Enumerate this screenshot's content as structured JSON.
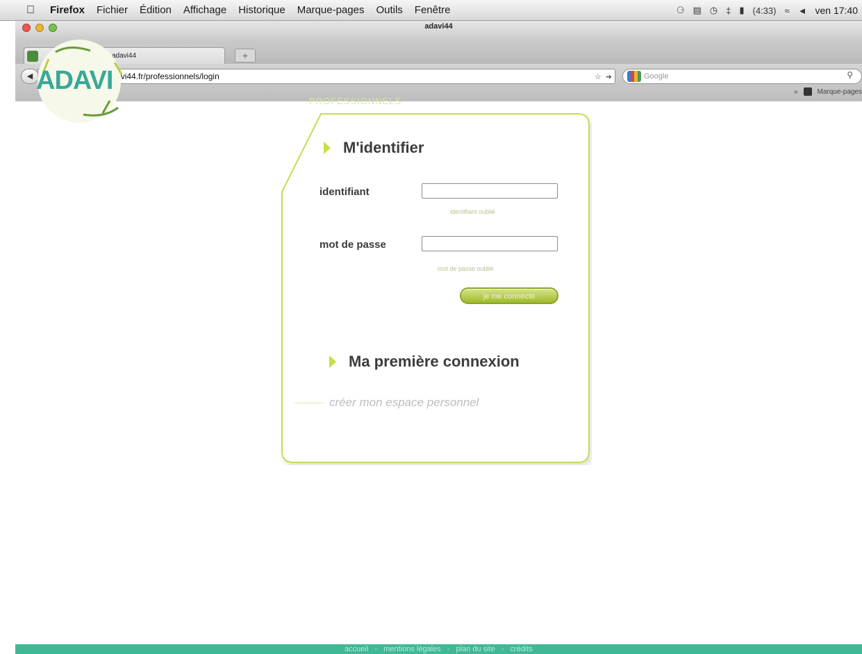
{
  "menubar": {
    "app": "Firefox",
    "items": [
      "Fichier",
      "Édition",
      "Affichage",
      "Historique",
      "Marque-pages",
      "Outils",
      "Fenêtre"
    ],
    "battery": "(4:33)",
    "clock": "ven 17:40"
  },
  "window": {
    "title": "adavi44",
    "tab_label": "adavi44",
    "new_tab": "+"
  },
  "nav": {
    "url": "www.adavi44.fr/professionnels/login",
    "search_placeholder": "Google",
    "bookmarks_label": "Marque-pages"
  },
  "page": {
    "logo_text": "ADAVI",
    "section_label": "PROFESSIONNELS",
    "login_heading": "M'identifier",
    "identifiant_label": "identifiant",
    "identifiant_forgot": "identifiant oublié",
    "password_label": "mot de passe",
    "password_forgot": "mot de passe oublié",
    "submit_label": "je me connecte",
    "first_heading": "Ma première connexion",
    "create_link": "créer mon espace personnel"
  },
  "footer": {
    "links": [
      "accueil",
      "mentions légales",
      "plan du site",
      "crédits"
    ],
    "separator": "-"
  },
  "colors": {
    "accent_green": "#c9dd45",
    "brand_teal": "#39a89a",
    "footer_teal": "#3fb895"
  }
}
